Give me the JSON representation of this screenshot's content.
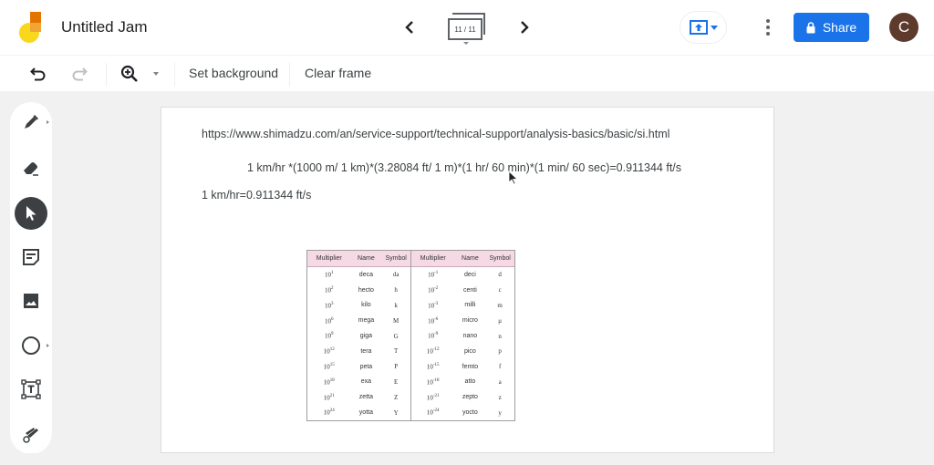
{
  "app": {
    "title": "Untitled Jam",
    "frame_indicator": "11 / 11",
    "share_label": "Share",
    "avatar_initial": "C",
    "colors": {
      "accent": "#1a73e8",
      "avatar_bg": "#5d3a2b",
      "logo_yellow": "#f9d71c",
      "logo_orange": "#e37400"
    }
  },
  "toolbar": {
    "set_background": "Set background",
    "clear_frame": "Clear frame",
    "zoom_dropdown": "-"
  },
  "sidebar": {
    "tools": [
      {
        "name": "pen",
        "icon": "pen-icon",
        "active": false
      },
      {
        "name": "eraser",
        "icon": "eraser-icon",
        "active": false
      },
      {
        "name": "select",
        "icon": "select-arrow-icon",
        "active": true
      },
      {
        "name": "sticky-note",
        "icon": "sticky-note-icon",
        "active": false
      },
      {
        "name": "image",
        "icon": "image-icon",
        "active": false
      },
      {
        "name": "circle",
        "icon": "circle-icon",
        "active": false
      },
      {
        "name": "text-box",
        "icon": "text-box-icon",
        "active": false
      },
      {
        "name": "laser",
        "icon": "laser-icon",
        "active": false
      }
    ]
  },
  "canvas": {
    "url_text": "https://www.shimadzu.com/an/service-support/technical-support/analysis-basics/basic/si.html",
    "equation": "1 km/hr *(1000 m/ 1 km)*(3.28084 ft/ 1 m)*(1 hr/ 60 min)*(1 min/ 60 sec)=0.911344 ft/s",
    "result": "1 km/hr=0.911344 ft/s",
    "si_table": {
      "headers": [
        "Multiplier",
        "Name",
        "Symbol"
      ],
      "left": [
        {
          "base": "10",
          "exp": "1",
          "name": "deca",
          "symbol": "da"
        },
        {
          "base": "10",
          "exp": "2",
          "name": "hecto",
          "symbol": "h"
        },
        {
          "base": "10",
          "exp": "3",
          "name": "kilo",
          "symbol": "k"
        },
        {
          "base": "10",
          "exp": "6",
          "name": "mega",
          "symbol": "M"
        },
        {
          "base": "10",
          "exp": "9",
          "name": "giga",
          "symbol": "G"
        },
        {
          "base": "10",
          "exp": "12",
          "name": "tera",
          "symbol": "T"
        },
        {
          "base": "10",
          "exp": "15",
          "name": "peta",
          "symbol": "P"
        },
        {
          "base": "10",
          "exp": "18",
          "name": "exa",
          "symbol": "E"
        },
        {
          "base": "10",
          "exp": "21",
          "name": "zetta",
          "symbol": "Z"
        },
        {
          "base": "10",
          "exp": "24",
          "name": "yotta",
          "symbol": "Y"
        }
      ],
      "right": [
        {
          "base": "10",
          "exp": "-1",
          "name": "deci",
          "symbol": "d"
        },
        {
          "base": "10",
          "exp": "-2",
          "name": "centi",
          "symbol": "c"
        },
        {
          "base": "10",
          "exp": "-3",
          "name": "milli",
          "symbol": "m"
        },
        {
          "base": "10",
          "exp": "-6",
          "name": "micro",
          "symbol": "μ"
        },
        {
          "base": "10",
          "exp": "-9",
          "name": "nano",
          "symbol": "n"
        },
        {
          "base": "10",
          "exp": "-12",
          "name": "pico",
          "symbol": "p"
        },
        {
          "base": "10",
          "exp": "-15",
          "name": "femto",
          "symbol": "f"
        },
        {
          "base": "10",
          "exp": "-18",
          "name": "atto",
          "symbol": "a"
        },
        {
          "base": "10",
          "exp": "-21",
          "name": "zepto",
          "symbol": "z"
        },
        {
          "base": "10",
          "exp": "-24",
          "name": "yocto",
          "symbol": "y"
        }
      ]
    }
  }
}
